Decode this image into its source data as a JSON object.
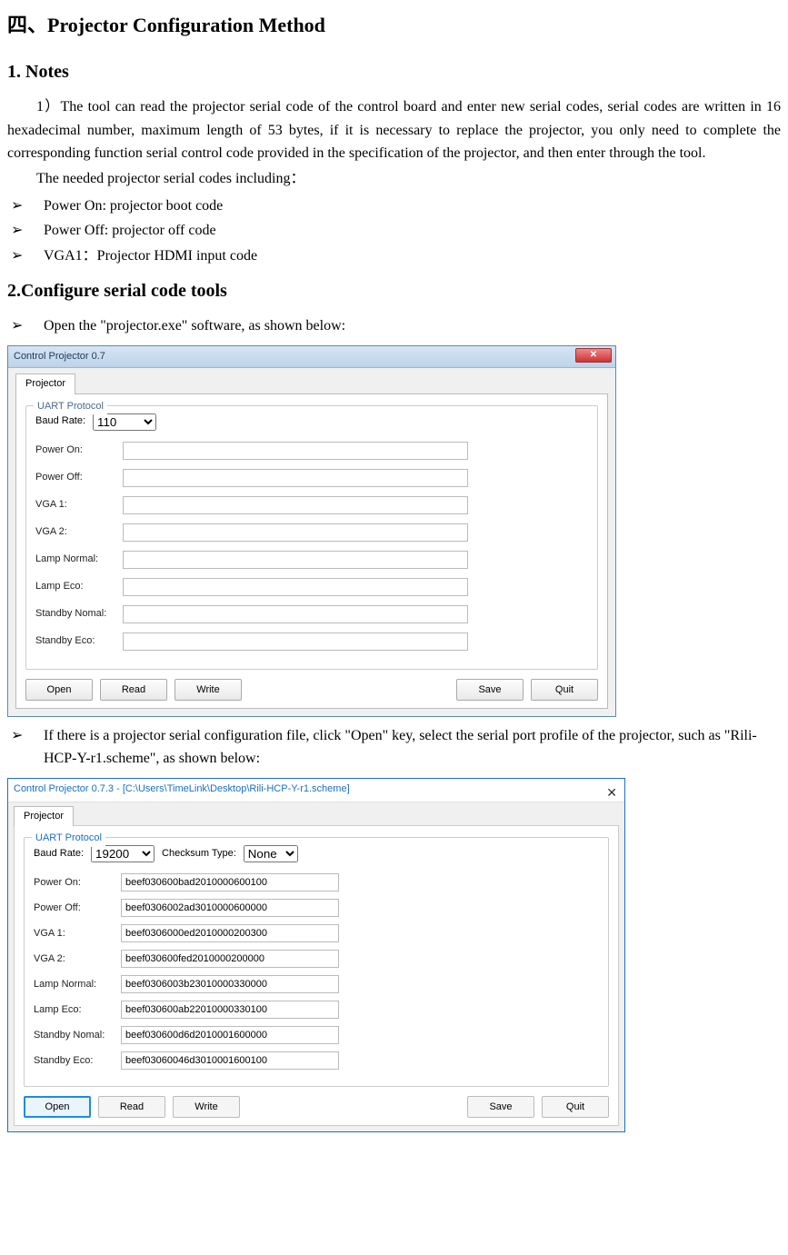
{
  "headings": {
    "main": "四、Projector Configuration Method",
    "notes": "1. Notes",
    "tools": "2.Configure serial code tools"
  },
  "paragraphs": {
    "p1": "1）The tool can read the projector serial code of the control board and enter new serial codes, serial codes are written in 16 hexadecimal number, maximum length of 53 bytes, if it is necessary to replace the projector, you only need to complete the corresponding function serial control code provided in the specification of the projector, and then enter through the tool.",
    "p2": "The needed projector serial codes including：",
    "p3": "Open the \"projector.exe\" software, as shown below:",
    "p4": "If there is a projector serial configuration file, click \"Open\" key, select the serial port profile of the projector, such as \"Rili-HCP-Y-r1.scheme\", as shown below:"
  },
  "bullets1": {
    "a": "Power On: projector boot code",
    "b": "Power Off: projector off code",
    "c": "VGA1：Projector HDMI input code"
  },
  "window1": {
    "title": "Control Projector 0.7",
    "close_icon": "✕",
    "tab": "Projector",
    "fieldset": "UART Protocol",
    "baud_label": "Baud Rate:",
    "baud_value": "110",
    "labels": {
      "power_on": "Power On:",
      "power_off": "Power Off:",
      "vga1": "VGA 1:",
      "vga2": "VGA 2:",
      "lamp_normal": "Lamp Normal:",
      "lamp_eco": "Lamp Eco:",
      "standby_normal": "Standby Nomal:",
      "standby_eco": "Standby Eco:"
    },
    "values": {
      "power_on": "",
      "power_off": "",
      "vga1": "",
      "vga2": "",
      "lamp_normal": "",
      "lamp_eco": "",
      "standby_normal": "",
      "standby_eco": ""
    },
    "buttons": {
      "open": "Open",
      "read": "Read",
      "write": "Write",
      "save": "Save",
      "quit": "Quit"
    }
  },
  "window2": {
    "title": "Control Projector 0.7.3 - [C:\\Users\\TimeLink\\Desktop\\Rili-HCP-Y-r1.scheme]",
    "close_icon": "✕",
    "tab": "Projector",
    "fieldset": "UART Protocol",
    "baud_label": "Baud Rate:",
    "baud_value": "19200",
    "checksum_label": "Checksum Type:",
    "checksum_value": "None",
    "labels": {
      "power_on": "Power On:",
      "power_off": "Power Off:",
      "vga1": "VGA 1:",
      "vga2": "VGA 2:",
      "lamp_normal": "Lamp Normal:",
      "lamp_eco": "Lamp Eco:",
      "standby_normal": "Standby Nomal:",
      "standby_eco": "Standby Eco:"
    },
    "values": {
      "power_on": "beef030600bad2010000600100",
      "power_off": "beef0306002ad3010000600000",
      "vga1": "beef0306000ed2010000200300",
      "vga2": "beef030600fed2010000200000",
      "lamp_normal": "beef0306003b23010000330000",
      "lamp_eco": "beef030600ab22010000330100",
      "standby_normal": "beef030600d6d2010001600000",
      "standby_eco": "beef03060046d3010001600100"
    },
    "buttons": {
      "open": "Open",
      "read": "Read",
      "write": "Write",
      "save": "Save",
      "quit": "Quit"
    }
  }
}
